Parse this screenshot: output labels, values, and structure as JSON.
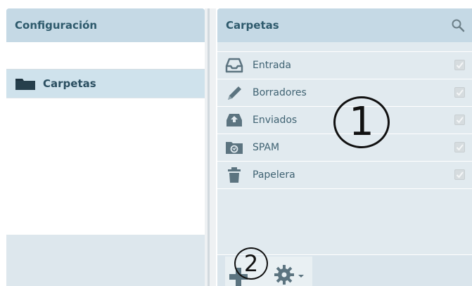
{
  "left_panel": {
    "title": "Configuración",
    "items": [
      {
        "label": "Carpetas",
        "icon": "folder-icon",
        "selected": true
      }
    ]
  },
  "right_panel": {
    "title": "Carpetas",
    "search_icon": "search-icon",
    "folders": [
      {
        "label": "Entrada",
        "icon": "inbox-icon",
        "subscribed": true
      },
      {
        "label": "Borradores",
        "icon": "pencil-icon",
        "subscribed": true
      },
      {
        "label": "Enviados",
        "icon": "sent-icon",
        "subscribed": true
      },
      {
        "label": "SPAM",
        "icon": "spam-icon",
        "subscribed": true
      },
      {
        "label": "Papelera",
        "icon": "trash-icon",
        "subscribed": true
      }
    ],
    "toolbar": {
      "add_icon": "plus-icon",
      "settings_icon": "gear-icon"
    }
  },
  "annotations": {
    "callout_1": "1",
    "callout_2": "2"
  },
  "colors": {
    "header_bg": "#c5d9e5",
    "header_text": "#2e5a6c",
    "panel_bg": "#e1eaef",
    "icon_color": "#5c7480"
  }
}
